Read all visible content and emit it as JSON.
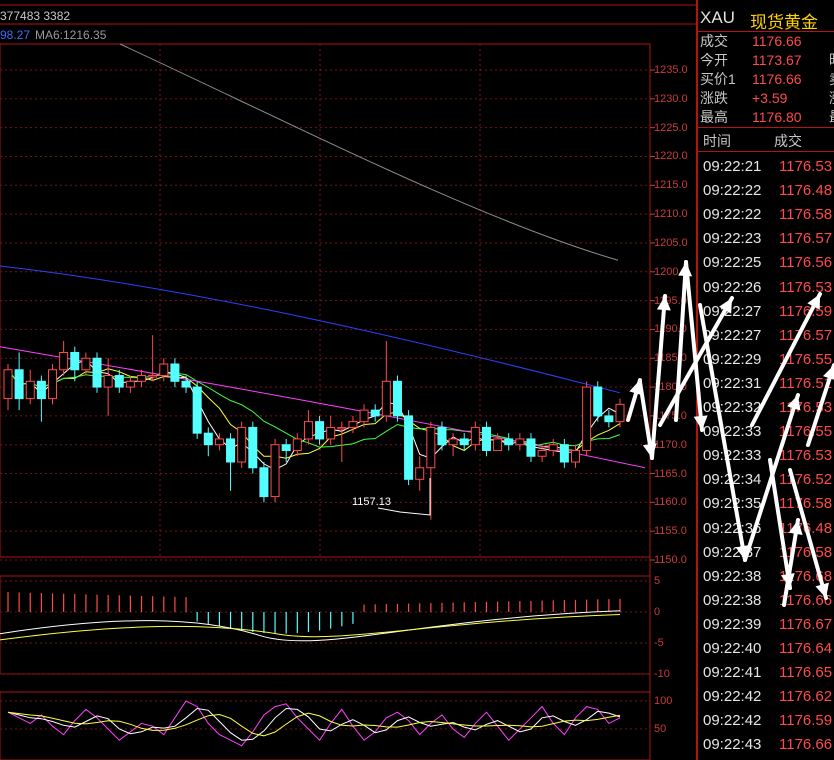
{
  "header": {
    "vol_text": "377483  3382",
    "ma_left": "98.27",
    "ma6": "MA6:1216.35"
  },
  "price_axis": [
    "1235.0",
    "1230.0",
    "1225.0",
    "1220.0",
    "1215.0",
    "1210.0",
    "1205.0",
    "1200.0",
    "1195.0",
    "1190.0",
    "1185.0",
    "1180.0",
    "1175.0",
    "1170.0",
    "1165.0",
    "1160.0",
    "1155.0",
    "1150.0"
  ],
  "low_annotation": "1157.13",
  "macd_axis": [
    "5",
    "0",
    "-5",
    "-10"
  ],
  "kdj_axis": [
    "100",
    "50"
  ],
  "quote": {
    "symbol": "XAU",
    "name": "现货黄金",
    "rows": [
      {
        "label": "成交",
        "value": "1176.66",
        "right": ""
      },
      {
        "label": "今开",
        "value": "1173.67",
        "right": "昨"
      },
      {
        "label": "买价1",
        "value": "1176.66",
        "right": "卖"
      },
      {
        "label": "涨跌",
        "value": "+3.59",
        "right": "涨"
      },
      {
        "label": "最高",
        "value": "1176.80",
        "right": "最"
      }
    ]
  },
  "ticks_header": {
    "time": "时间",
    "price": "成交"
  },
  "ticks": [
    {
      "time": "09:22:21",
      "price": "1176.53"
    },
    {
      "time": "09:22:22",
      "price": "1176.48"
    },
    {
      "time": "09:22:22",
      "price": "1176.58"
    },
    {
      "time": "09:22:23",
      "price": "1176.57"
    },
    {
      "time": "09:22:25",
      "price": "1176.56"
    },
    {
      "time": "09:22:26",
      "price": "1176.53"
    },
    {
      "time": "09:22:27",
      "price": "1176.59"
    },
    {
      "time": "09:22:27",
      "price": "1176.57"
    },
    {
      "time": "09:22:29",
      "price": "1176.55"
    },
    {
      "time": "09:22:31",
      "price": "1176.51"
    },
    {
      "time": "09:22:32",
      "price": "1176.53"
    },
    {
      "time": "09:22:33",
      "price": "1176.55"
    },
    {
      "time": "09:22:33",
      "price": "1176.53"
    },
    {
      "time": "09:22:34",
      "price": "1176.52"
    },
    {
      "time": "09:22:35",
      "price": "1176.58"
    },
    {
      "time": "09:22:36",
      "price": "1176.48"
    },
    {
      "time": "09:22:37",
      "price": "1176.58"
    },
    {
      "time": "09:22:38",
      "price": "1176.68"
    },
    {
      "time": "09:22:38",
      "price": "1176.66"
    },
    {
      "time": "09:22:39",
      "price": "1176.67"
    },
    {
      "time": "09:22:40",
      "price": "1176.64"
    },
    {
      "time": "09:22:41",
      "price": "1176.65"
    },
    {
      "time": "09:22:42",
      "price": "1176.62"
    },
    {
      "time": "09:22:42",
      "price": "1176.59"
    },
    {
      "time": "09:22:43",
      "price": "1176.66"
    }
  ],
  "candles": [
    {
      "o": 1178,
      "c": 1183,
      "h": 1184,
      "l": 1176
    },
    {
      "o": 1183,
      "c": 1178,
      "h": 1186,
      "l": 1176
    },
    {
      "o": 1178,
      "c": 1181,
      "h": 1183,
      "l": 1177
    },
    {
      "o": 1181,
      "c": 1178,
      "h": 1182,
      "l": 1174
    },
    {
      "o": 1178,
      "c": 1183,
      "h": 1184,
      "l": 1177
    },
    {
      "o": 1183,
      "c": 1186,
      "h": 1188,
      "l": 1182
    },
    {
      "o": 1186,
      "c": 1183,
      "h": 1187,
      "l": 1181
    },
    {
      "o": 1183,
      "c": 1185,
      "h": 1186,
      "l": 1182
    },
    {
      "o": 1185,
      "c": 1180,
      "h": 1186,
      "l": 1179
    },
    {
      "o": 1180,
      "c": 1182,
      "h": 1185,
      "l": 1175
    },
    {
      "o": 1182,
      "c": 1180,
      "h": 1183,
      "l": 1179
    },
    {
      "o": 1180,
      "c": 1181,
      "h": 1182,
      "l": 1179
    },
    {
      "o": 1181,
      "c": 1182,
      "h": 1183,
      "l": 1180
    },
    {
      "o": 1182,
      "c": 1182,
      "h": 1189,
      "l": 1181
    },
    {
      "o": 1182,
      "c": 1184,
      "h": 1185,
      "l": 1181
    },
    {
      "o": 1184,
      "c": 1181,
      "h": 1185,
      "l": 1180
    },
    {
      "o": 1181,
      "c": 1180,
      "h": 1182,
      "l": 1179
    },
    {
      "o": 1180,
      "c": 1172,
      "h": 1181,
      "l": 1171
    },
    {
      "o": 1172,
      "c": 1170,
      "h": 1173,
      "l": 1168
    },
    {
      "o": 1170,
      "c": 1171,
      "h": 1172,
      "l": 1169
    },
    {
      "o": 1171,
      "c": 1167,
      "h": 1172,
      "l": 1162
    },
    {
      "o": 1167,
      "c": 1173,
      "h": 1174,
      "l": 1166
    },
    {
      "o": 1173,
      "c": 1166,
      "h": 1174,
      "l": 1165
    },
    {
      "o": 1166,
      "c": 1161,
      "h": 1167,
      "l": 1160
    },
    {
      "o": 1161,
      "c": 1170,
      "h": 1171,
      "l": 1160
    },
    {
      "o": 1170,
      "c": 1169,
      "h": 1171,
      "l": 1167
    },
    {
      "o": 1169,
      "c": 1171,
      "h": 1172,
      "l": 1168
    },
    {
      "o": 1171,
      "c": 1174,
      "h": 1176,
      "l": 1170
    },
    {
      "o": 1174,
      "c": 1171,
      "h": 1175,
      "l": 1170
    },
    {
      "o": 1171,
      "c": 1173,
      "h": 1175,
      "l": 1170
    },
    {
      "o": 1173,
      "c": 1173,
      "h": 1174,
      "l": 1167
    },
    {
      "o": 1173,
      "c": 1174,
      "h": 1175,
      "l": 1172
    },
    {
      "o": 1174,
      "c": 1176,
      "h": 1177,
      "l": 1173
    },
    {
      "o": 1176,
      "c": 1175,
      "h": 1177,
      "l": 1174
    },
    {
      "o": 1175,
      "c": 1181,
      "h": 1188,
      "l": 1174
    },
    {
      "o": 1181,
      "c": 1175,
      "h": 1182,
      "l": 1174
    },
    {
      "o": 1175,
      "c": 1164,
      "h": 1176,
      "l": 1163
    },
    {
      "o": 1164,
      "c": 1166,
      "h": 1168,
      "l": 1162
    },
    {
      "o": 1166,
      "c": 1173,
      "h": 1174,
      "l": 1157
    },
    {
      "o": 1173,
      "c": 1170,
      "h": 1174,
      "l": 1169
    },
    {
      "o": 1170,
      "c": 1171,
      "h": 1172,
      "l": 1168
    },
    {
      "o": 1171,
      "c": 1170,
      "h": 1172,
      "l": 1169
    },
    {
      "o": 1170,
      "c": 1173,
      "h": 1174,
      "l": 1169
    },
    {
      "o": 1173,
      "c": 1169,
      "h": 1174,
      "l": 1168
    },
    {
      "o": 1169,
      "c": 1171,
      "h": 1172,
      "l": 1169
    },
    {
      "o": 1171,
      "c": 1170,
      "h": 1172,
      "l": 1169
    },
    {
      "o": 1170,
      "c": 1171,
      "h": 1172,
      "l": 1169
    },
    {
      "o": 1171,
      "c": 1168,
      "h": 1172,
      "l": 1167
    },
    {
      "o": 1168,
      "c": 1169,
      "h": 1170,
      "l": 1167
    },
    {
      "o": 1169,
      "c": 1170,
      "h": 1171,
      "l": 1168
    },
    {
      "o": 1170,
      "c": 1167,
      "h": 1171,
      "l": 1166
    },
    {
      "o": 1167,
      "c": 1169,
      "h": 1170,
      "l": 1166
    },
    {
      "o": 1169,
      "c": 1180,
      "h": 1181,
      "l": 1168
    },
    {
      "o": 1180,
      "c": 1175,
      "h": 1181,
      "l": 1174
    },
    {
      "o": 1175,
      "c": 1174,
      "h": 1176,
      "l": 1173
    },
    {
      "o": 1174,
      "c": 1177,
      "h": 1178,
      "l": 1173
    }
  ],
  "colors": {
    "up": "#ff4b4b",
    "down": "#54ffff",
    "grid": "#7a1212",
    "ma_white": "#ffffff",
    "ma_yellow": "#ffff40",
    "ma_green": "#40ff40",
    "ma_magenta": "#ff40ff",
    "ma_blue": "#3040ff",
    "ma_gray": "#8c8c8c",
    "ma6_text": "#9a9a9a",
    "ma_left_text": "#3c6cff",
    "symbol_text": "#e0e0e0",
    "name_text": "#ffd400"
  }
}
